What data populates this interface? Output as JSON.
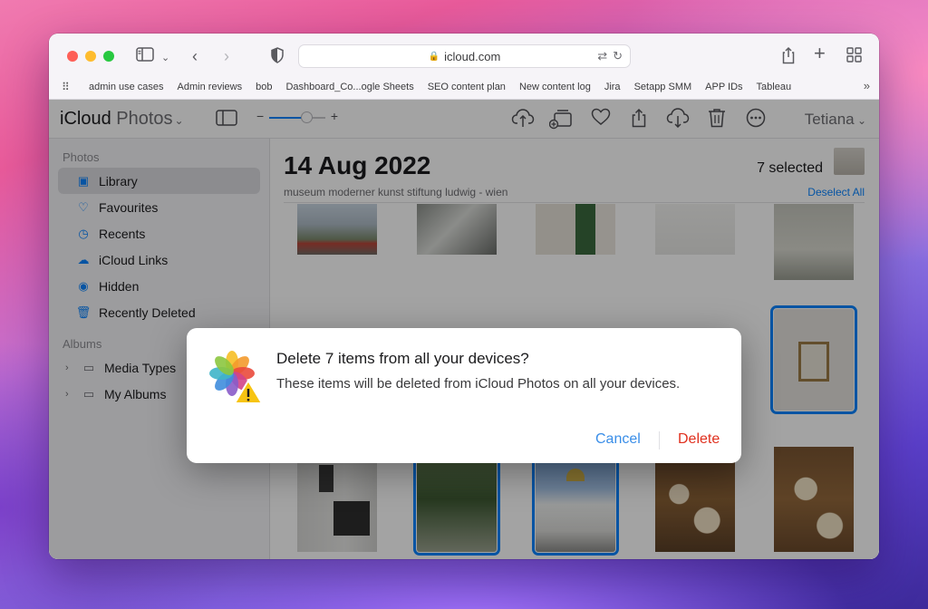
{
  "browser": {
    "url": "icloud.com",
    "bookmarks": [
      "admin use cases",
      "Admin reviews",
      "bob",
      "Dashboard_Co...ogle Sheets",
      "SEO content plan",
      "New content log",
      "Jira",
      "Setapp SMM",
      "APP IDs",
      "Tableau"
    ],
    "bookmarks_more": "»"
  },
  "app": {
    "brand": "iCloud",
    "section": "Photos",
    "user": "Tetiana"
  },
  "sidebar": {
    "photos_title": "Photos",
    "items": [
      {
        "label": "Library",
        "icon": "library-icon"
      },
      {
        "label": "Favourites",
        "icon": "heart-icon"
      },
      {
        "label": "Recents",
        "icon": "clock-icon"
      },
      {
        "label": "iCloud Links",
        "icon": "cloud-link-icon"
      },
      {
        "label": "Hidden",
        "icon": "eye-slash-icon"
      },
      {
        "label": "Recently Deleted",
        "icon": "trash-icon"
      }
    ],
    "albums_title": "Albums",
    "albums": [
      {
        "label": "Media Types",
        "icon": "folder-icon"
      },
      {
        "label": "My Albums",
        "icon": "folder-icon"
      }
    ]
  },
  "main": {
    "date": "14 Aug 2022",
    "location": "museum moderner kunst stiftung ludwig - wien",
    "selected": "7 selected",
    "deselect": "Deselect All"
  },
  "dialog": {
    "title": "Delete 7 items from all your devices?",
    "message": "These items will be deleted from iCloud Photos on all your devices.",
    "cancel": "Cancel",
    "delete": "Delete"
  },
  "colors": {
    "accent": "#0a84ff",
    "destructive": "#e0301e"
  }
}
